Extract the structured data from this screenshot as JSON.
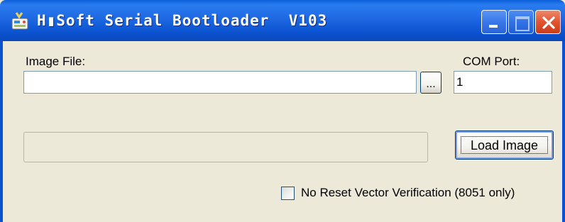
{
  "window": {
    "title": "H▮Soft Serial Bootloader  V103",
    "controls": {
      "minimize": "minimize-icon",
      "maximize": "maximize-icon",
      "close": "close-icon"
    },
    "colors": {
      "titlebar": "#0a52cf",
      "close": "#e1542f",
      "face": "#ece9d8"
    }
  },
  "image_file": {
    "label": "Image File:",
    "value": "",
    "browse_label": "..."
  },
  "com_port": {
    "label": "COM Port:",
    "value": "1"
  },
  "progress": {
    "value": 0
  },
  "load_button": {
    "label": "Load Image"
  },
  "option": {
    "label": "No Reset Vector Verification (8051 only)",
    "checked": false
  }
}
